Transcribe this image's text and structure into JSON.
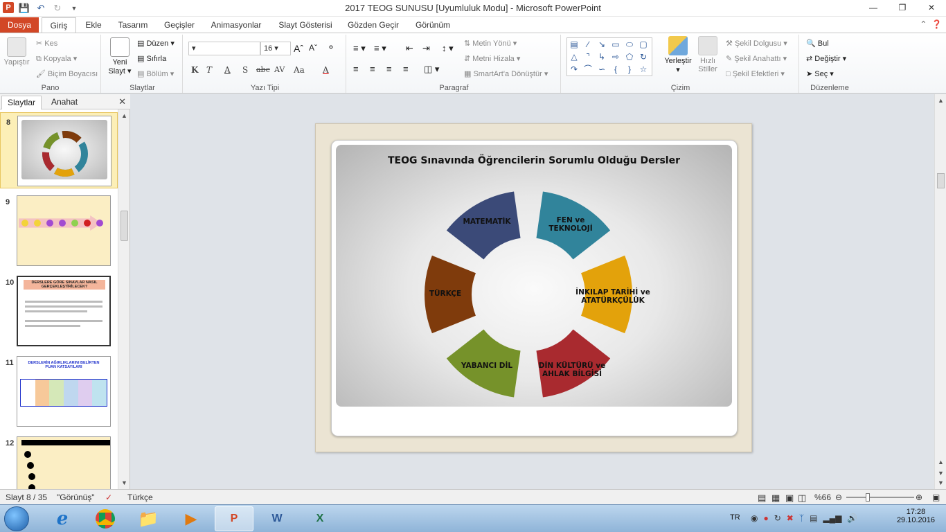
{
  "window": {
    "title": "2017 TEOG SUNUSU [Uyumluluk Modu] - Microsoft PowerPoint",
    "app_icon_letter": "P"
  },
  "tabs": [
    "Dosya",
    "Giriş",
    "Ekle",
    "Tasarım",
    "Geçişler",
    "Animasyonlar",
    "Slayt Gösterisi",
    "Gözden Geçir",
    "Görünüm"
  ],
  "ribbon": {
    "pano": {
      "label": "Pano",
      "paste": "Yapıştır",
      "cut": "Kes",
      "copy": "Kopyala",
      "format_painter": "Biçim Boyacısı"
    },
    "slaytlar": {
      "label": "Slaytlar",
      "new_slide_line1": "Yeni",
      "new_slide_line2": "Slayt",
      "layout": "Düzen",
      "reset": "Sıfırla",
      "section": "Bölüm"
    },
    "yazi_tipi": {
      "label": "Yazı Tipi",
      "font_size": "16",
      "buttons": [
        "K",
        "T",
        "A",
        "S",
        "abc",
        "AV",
        "Aa",
        "A"
      ]
    },
    "paragraf": {
      "label": "Paragraf",
      "text_direction": "Metin Yönü",
      "align_text": "Metni Hizala",
      "smartart": "SmartArt'a Dönüştür"
    },
    "cizim": {
      "label": "Çizim",
      "arrange": "Yerleştir",
      "quick_styles_line1": "Hızlı",
      "quick_styles_line2": "Stiller",
      "shape_fill": "Şekil Dolgusu",
      "shape_outline": "Şekil Anahattı",
      "shape_effects": "Şekil Efektleri"
    },
    "duzenleme": {
      "label": "Düzenleme",
      "find": "Bul",
      "replace": "Değiştir",
      "select": "Seç"
    }
  },
  "panel": {
    "tab_slides": "Slaytlar",
    "tab_outline": "Anahat",
    "thumbnails": [
      {
        "num": "8"
      },
      {
        "num": "9"
      },
      {
        "num": "10",
        "title": "DERSLERE GÖRE SINAVLAR NASIL GERÇEKLEŞTİRİLECEK?"
      },
      {
        "num": "11",
        "title": "DERSLERİN AĞIRLIKLARINI BELİRTEN PUAN KATSAYILARI"
      },
      {
        "num": "12"
      }
    ]
  },
  "slide": {
    "title": "TEOG Sınavında  Öğrencilerin  Sorumlu Olduğu Dersler",
    "segments": [
      {
        "label": "FEN ve TEKNOLOJİ",
        "color": "#31849b"
      },
      {
        "label": "İNKILAP TARİHİ ve ATATÜRKÇÜLÜK",
        "color": "#e3a20b"
      },
      {
        "label": "DİN KÜLTÜRÜ ve AHLAK BİLGİSİ",
        "color": "#a92a2f"
      },
      {
        "label": "YABANCI DİL",
        "color": "#76922a"
      },
      {
        "label": "TÜRKÇE",
        "color": "#7f3b0c"
      },
      {
        "label": "MATEMATİK",
        "color": "#3b4a78"
      }
    ]
  },
  "status": {
    "slide_info": "Slayt 8 / 35",
    "theme": "\"Görünüş\"",
    "language": "Türkçe",
    "zoom": "%66"
  },
  "taskbar": {
    "lang": "TR",
    "time": "17:28",
    "date": "29.10.2016"
  }
}
